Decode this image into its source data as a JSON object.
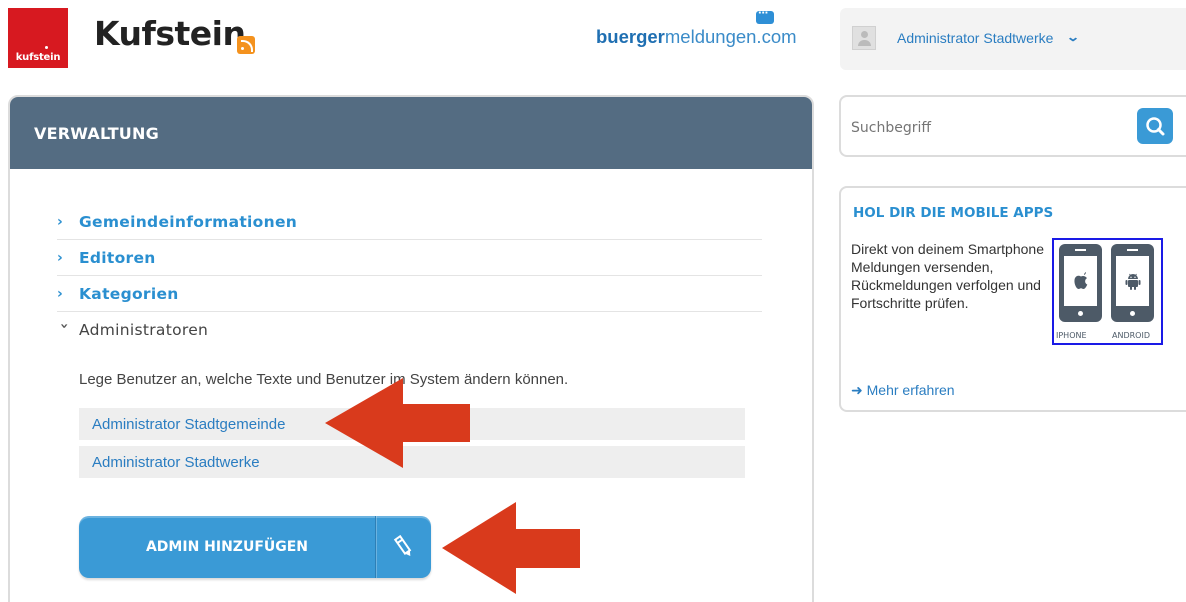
{
  "header": {
    "logo_text": "kufstein",
    "town_name": "Kufstein",
    "brand_bold": "buerger",
    "brand_rest": "meldungen.com",
    "user_name": "Administrator Stadtwerke"
  },
  "panel": {
    "title": "VERWALTUNG",
    "menu": [
      {
        "label": "Gemeindeinformationen",
        "expanded": false
      },
      {
        "label": "Editoren",
        "expanded": false
      },
      {
        "label": "Kategorien",
        "expanded": false
      },
      {
        "label": "Administratoren",
        "expanded": true
      }
    ],
    "admin_description": "Lege Benutzer an, welche Texte und Benutzer im System ändern können.",
    "admins": [
      "Administrator Stadtgemeinde",
      "Administrator Stadtwerke"
    ],
    "add_button_label": "ADMIN HINZUFÜGEN"
  },
  "sidebar": {
    "search_placeholder": "Suchbegriff",
    "apps_title": "HOL DIR DIE MOBILE APPS",
    "apps_text": "Direkt von deinem Smartphone Meldungen versenden, Rückmeldungen verfolgen und Fortschritte prüfen.",
    "apps_more": "➜ Mehr erfahren",
    "phone_labels": [
      "IPHONE",
      "ANDROID"
    ]
  },
  "colors": {
    "brand_red": "#d71920",
    "panel_header": "#546c82",
    "accent_blue": "#3a9ad6",
    "link_blue": "#2a8fd0",
    "arrow_red": "#d93a1c"
  }
}
